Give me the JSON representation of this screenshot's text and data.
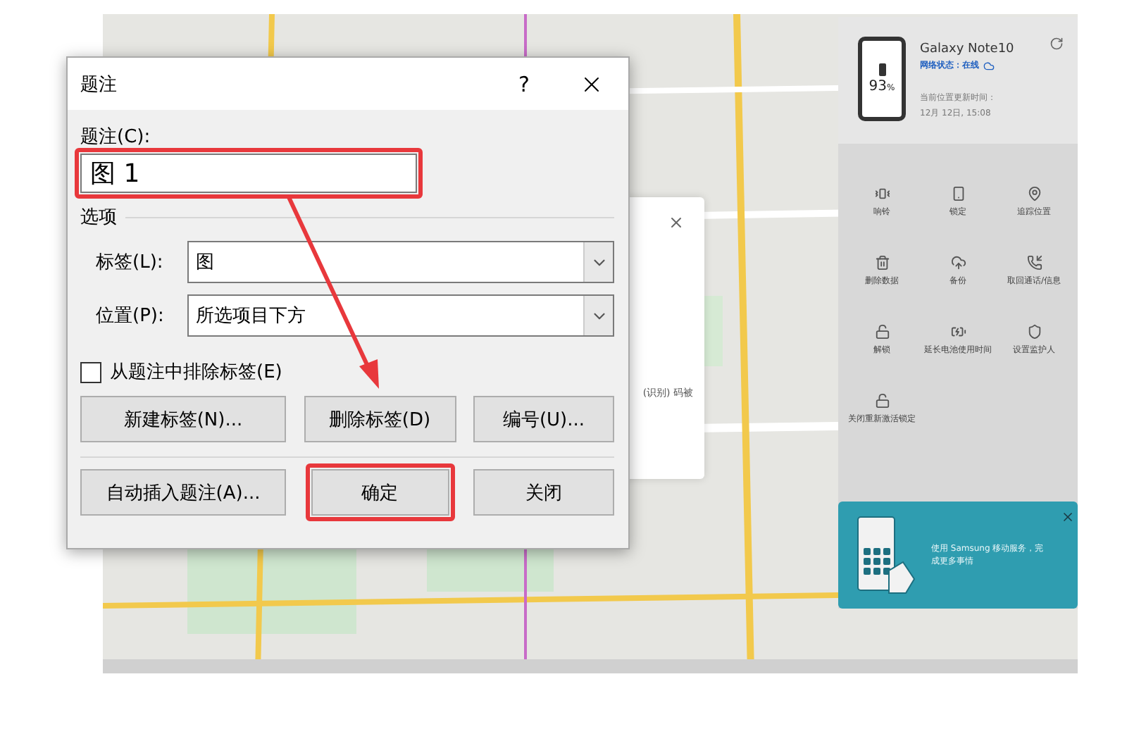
{
  "device": {
    "name": "Galaxy Note10",
    "battery": "93",
    "battery_unit": "%",
    "status": "网络状态：在线",
    "updated_label": "当前位置更新时间：",
    "updated_time": "12月 12日, 15:08",
    "actions": [
      {
        "label": "响铃"
      },
      {
        "label": "锁定"
      },
      {
        "label": "追踪位置"
      },
      {
        "label": "删除数据"
      },
      {
        "label": "备份"
      },
      {
        "label": "取回通话/信息"
      },
      {
        "label": "解锁"
      },
      {
        "label": "延长电池使用时间"
      },
      {
        "label": "设置监护人"
      },
      {
        "label": "关闭重新激活锁定"
      }
    ]
  },
  "toast": {
    "text": "使用 Samsung 移动服务，完成更多事情"
  },
  "popup": {
    "text": "(识别) 码被"
  },
  "dialog": {
    "title": "题注",
    "help": "?",
    "caption_label": "题注(C):",
    "caption_value": "图 1",
    "caption_highlighted": true,
    "options_heading": "选项",
    "fields": [
      {
        "label": "标签(L):",
        "value": "图"
      },
      {
        "label": "位置(P):",
        "value": "所选项目下方"
      }
    ],
    "exclude": {
      "label": "从题注中排除标签(E)",
      "checked": false
    },
    "buttons": [
      {
        "label": "新建标签(N)...",
        "highlighted": false
      },
      {
        "label": "删除标签(D)",
        "highlighted": false
      },
      {
        "label": "编号(U)...",
        "highlighted": false
      }
    ],
    "footer_buttons": [
      {
        "label": "自动插入题注(A)...",
        "highlighted": false
      },
      {
        "label": "确定",
        "highlighted": true
      },
      {
        "label": "关闭",
        "highlighted": false
      }
    ]
  }
}
